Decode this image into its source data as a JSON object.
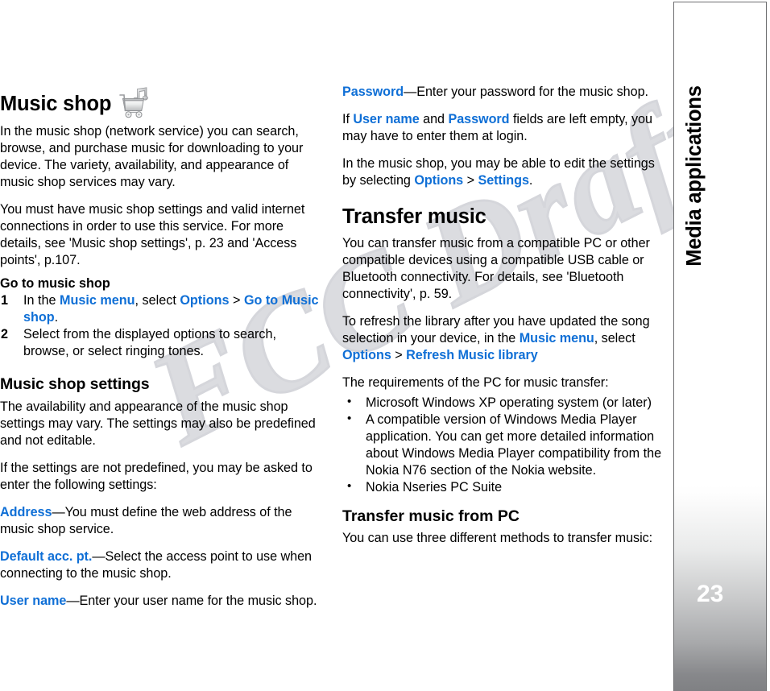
{
  "document": {
    "watermark": "FCC Draft",
    "sidebar": {
      "chapter_label": "Media applications",
      "page_number": "23"
    }
  },
  "left_column": {
    "heading": "Music shop",
    "heading_icon": "music-shop-cart-icon",
    "paragraph_1": "In the music shop (network service) you can search, browse, and purchase music for downloading to your device. The variety, availability, and appearance of music shop services may vary.",
    "paragraph_2": "You must have music shop settings and valid internet connections in order to use this service. For more details, see 'Music shop settings', p. 23 and 'Access points', p.107.",
    "go_to_heading": "Go to music shop",
    "steps": [
      {
        "number": "1",
        "pre": "In the ",
        "link1": "Music menu",
        "mid1": ", select ",
        "link2": "Options",
        "sep": " > ",
        "link3": "Go to Music shop",
        "post": "."
      },
      {
        "number": "2",
        "text": "Select from the displayed options to search, browse, or select ringing tones."
      }
    ],
    "settings_heading": "Music shop settings",
    "paragraph_3": "The availability and appearance of the music shop settings may vary. The settings may also be predefined and not editable.",
    "paragraph_4": "If the settings are not predefined, you may be asked to enter the following settings:",
    "settings": [
      {
        "term": "Address",
        "desc": "—You must define the web address of the music shop service."
      },
      {
        "term": "Default acc. pt.",
        "desc": "—Select the access point to use when connecting to the music shop."
      },
      {
        "term": "User name",
        "desc": "—Enter your user name for the music shop."
      }
    ]
  },
  "right_column": {
    "password_term": "Password",
    "password_desc": "—Enter your password for the music shop.",
    "empty_fields": {
      "pre": "If ",
      "link1": "User name",
      "mid": " and ",
      "link2": "Password",
      "post": " fields are left empty, you may have to enter them at login."
    },
    "edit_settings": {
      "pre": "In the music shop, you may be able to edit the settings by selecting ",
      "link1": "Options",
      "sep": " > ",
      "link2": "Settings",
      "post": "."
    },
    "transfer_heading": "Transfer music",
    "paragraph_1": "You can transfer music from a compatible PC or other compatible devices using a compatible USB cable or Bluetooth connectivity. For details, see 'Bluetooth connectivity', p. 59.",
    "refresh": {
      "pre": "To refresh the library after you have updated the song selection in your device, in the ",
      "link1": "Music menu",
      "mid": ", select ",
      "link2": "Options",
      "sep": " > ",
      "link3": "Refresh Music library"
    },
    "requirements_intro": "The requirements of the PC for music transfer:",
    "requirements": [
      "Microsoft Windows XP operating system (or later)",
      "A compatible version of Windows Media Player application. You can get more detailed information about Windows Media Player compatibility from the Nokia N76 section of the Nokia website.",
      "Nokia Nseries PC Suite"
    ],
    "from_pc_heading": "Transfer music from PC",
    "from_pc_text": "You can use three different methods to transfer music:"
  },
  "colors": {
    "link_blue": "#0f6fd6",
    "body_black": "#000000",
    "sidebar_border": "#6d6e70",
    "watermark_gray": "#d9dade",
    "page_number_white": "#ffffff"
  }
}
